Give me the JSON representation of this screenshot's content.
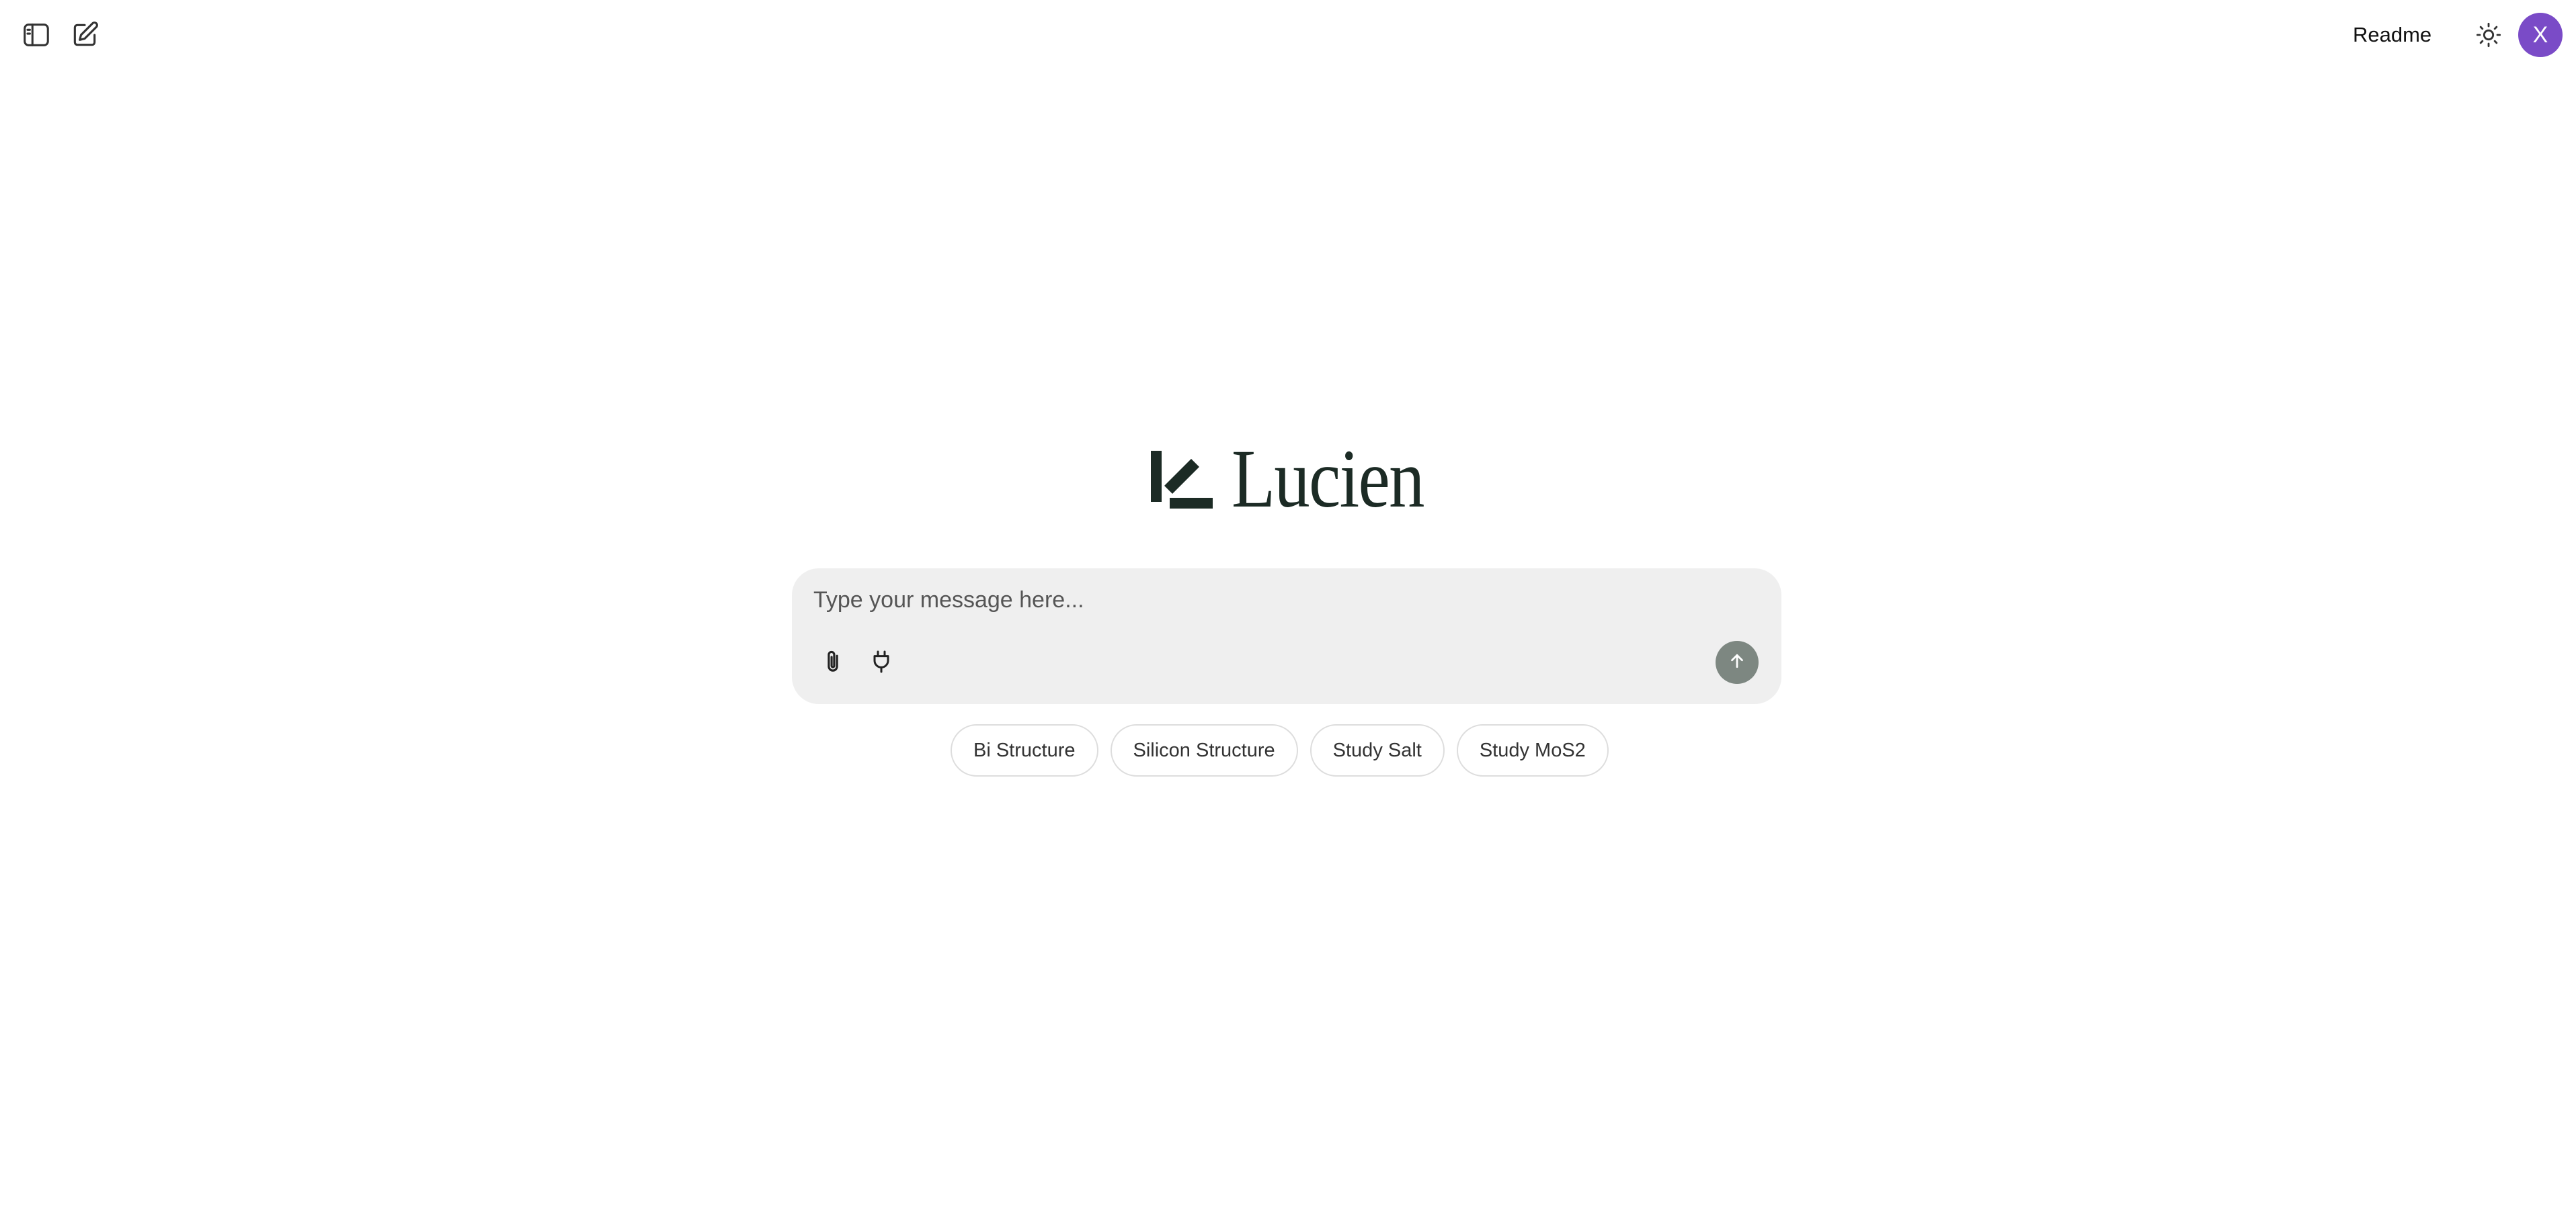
{
  "header": {
    "readme_label": "Readme",
    "avatar_initial": "X",
    "avatar_color": "#7a4bc7",
    "icons": {
      "sidebar_toggle": "sidebar-panel-icon",
      "new_chat": "edit-square-icon",
      "theme_toggle": "sun-icon"
    }
  },
  "logo": {
    "wordmark": "Lucien",
    "color": "#1c2b25"
  },
  "composer": {
    "placeholder": "Type your message here...",
    "value": "",
    "background": "#efefef",
    "send_button_color": "#7d8781",
    "icons": {
      "attach": "paperclip-icon",
      "plugins": "plug-icon",
      "send": "arrow-up-icon"
    }
  },
  "suggestions": [
    {
      "label": "Bi Structure"
    },
    {
      "label": "Silicon Structure"
    },
    {
      "label": "Study Salt"
    },
    {
      "label": "Study MoS2"
    }
  ]
}
